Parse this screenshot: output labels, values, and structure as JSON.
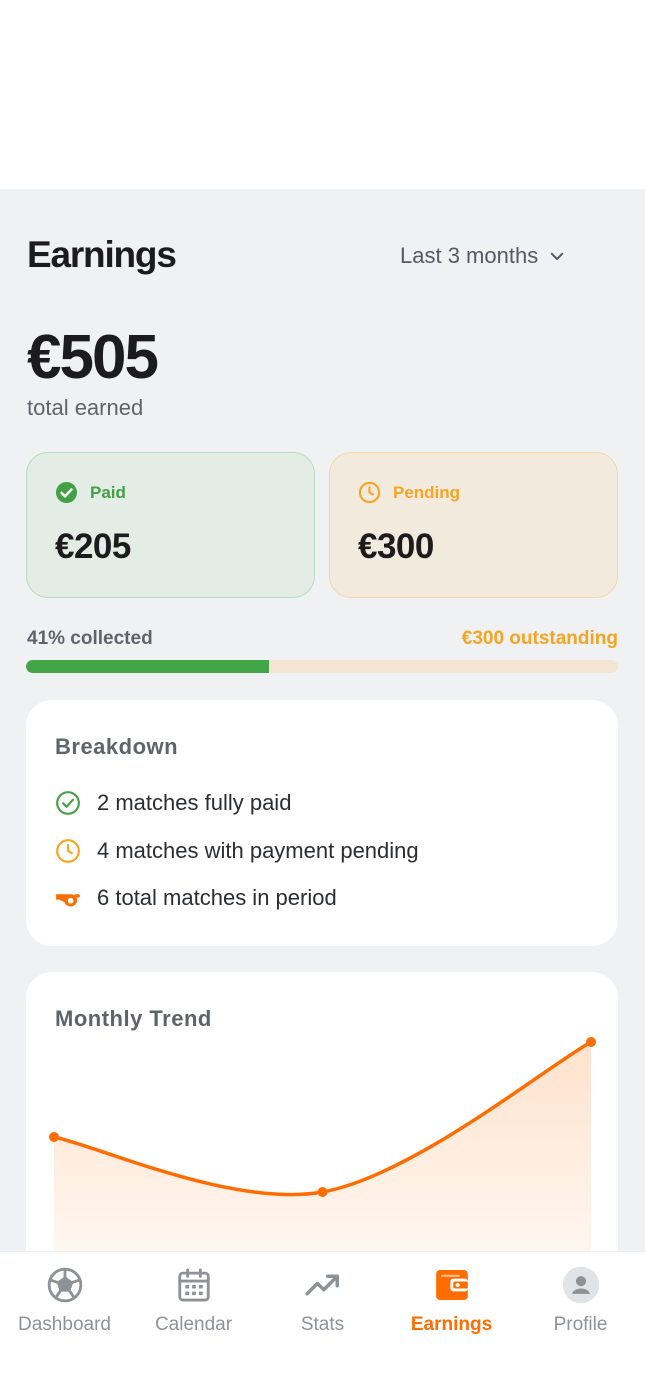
{
  "header": {
    "title": "Earnings",
    "period_label": "Last 3 months"
  },
  "summary": {
    "total_amount": "€505",
    "total_label": "total earned",
    "paid_label": "Paid",
    "paid_amount": "€205",
    "pending_label": "Pending",
    "pending_amount": "€300",
    "collected_text": "41% collected",
    "outstanding_text": "€300 outstanding",
    "collected_fraction": 0.41
  },
  "breakdown": {
    "title": "Breakdown",
    "items": [
      {
        "icon": "check-circle-icon",
        "text": "2 matches fully paid"
      },
      {
        "icon": "clock-icon",
        "text": "4 matches with payment pending"
      },
      {
        "icon": "whistle-icon",
        "text": "6 total matches in period"
      }
    ]
  },
  "trend": {
    "title": "Monthly Trend"
  },
  "chart_data": {
    "type": "area",
    "title": "Monthly Trend",
    "x": [
      "",
      "",
      ""
    ],
    "values": [
      155,
      100,
      250
    ],
    "ylim": [
      0,
      320
    ],
    "grid": false,
    "color": "#ff6d00"
  },
  "colors": {
    "accent": "#ff6d00",
    "paid": "#43a047",
    "pending": "#f5a524"
  },
  "nav": {
    "items": [
      {
        "label": "Dashboard",
        "icon": "soccer-ball-icon",
        "active": false
      },
      {
        "label": "Calendar",
        "icon": "calendar-icon",
        "active": false
      },
      {
        "label": "Stats",
        "icon": "trend-up-icon",
        "active": false
      },
      {
        "label": "Earnings",
        "icon": "wallet-icon",
        "active": true
      },
      {
        "label": "Profile",
        "icon": "avatar-icon",
        "active": false
      }
    ]
  }
}
